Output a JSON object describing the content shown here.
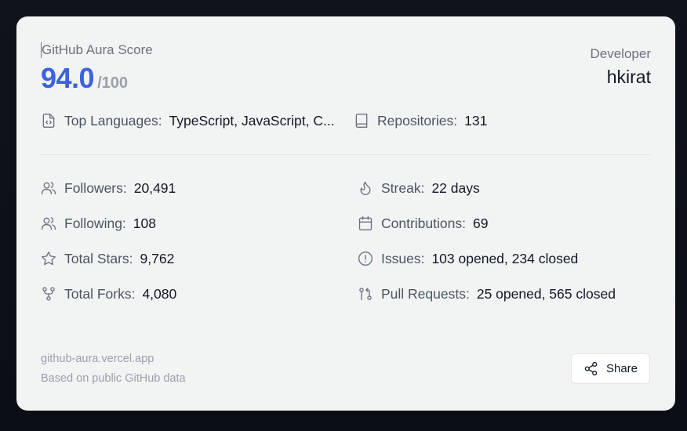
{
  "card": {
    "score_label": "GitHub Aura Score",
    "score_value": "94.0",
    "score_max": "/100",
    "developer_label": "Developer",
    "developer_name": "hkirat"
  },
  "summary": {
    "languages": {
      "label": "Top Languages:",
      "value": "TypeScript, JavaScript, C...",
      "icon": "file-code-icon"
    },
    "repositories": {
      "label": "Repositories:",
      "value": "131",
      "icon": "book-icon"
    }
  },
  "stats_left": [
    {
      "label": "Followers:",
      "value": "20,491",
      "icon": "users-icon"
    },
    {
      "label": "Following:",
      "value": "108",
      "icon": "users-icon"
    },
    {
      "label": "Total Stars:",
      "value": "9,762",
      "icon": "star-icon"
    },
    {
      "label": "Total Forks:",
      "value": "4,080",
      "icon": "git-fork-icon"
    }
  ],
  "stats_right": [
    {
      "label": "Streak:",
      "value": "22 days",
      "icon": "flame-icon"
    },
    {
      "label": "Contributions:",
      "value": "69",
      "icon": "calendar-icon"
    },
    {
      "label": "Issues:",
      "value": "103 opened, 234 closed",
      "icon": "alert-circle-icon"
    },
    {
      "label": "Pull Requests:",
      "value": "25 opened, 565 closed",
      "icon": "git-pull-request-icon"
    }
  ],
  "footer": {
    "url": "github-aura.vercel.app",
    "note": "Based on public GitHub data",
    "share_label": "Share"
  },
  "colors": {
    "accent": "#3b63e0",
    "card_bg": "#f2f3f3",
    "page_bg": "#0c0f17"
  }
}
